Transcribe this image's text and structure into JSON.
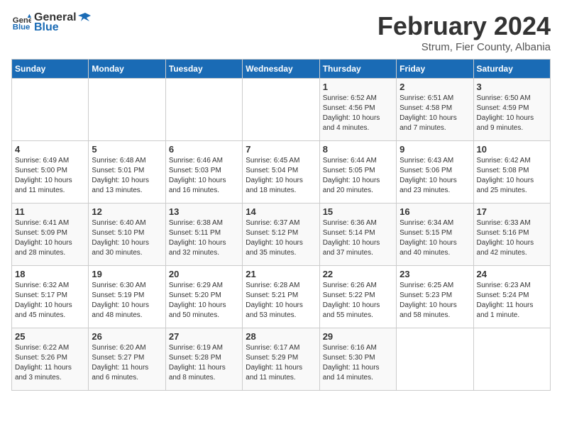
{
  "header": {
    "logo_general": "General",
    "logo_blue": "Blue",
    "month_title": "February 2024",
    "subtitle": "Strum, Fier County, Albania"
  },
  "days_of_week": [
    "Sunday",
    "Monday",
    "Tuesday",
    "Wednesday",
    "Thursday",
    "Friday",
    "Saturday"
  ],
  "weeks": [
    [
      {
        "day": "",
        "info": ""
      },
      {
        "day": "",
        "info": ""
      },
      {
        "day": "",
        "info": ""
      },
      {
        "day": "",
        "info": ""
      },
      {
        "day": "1",
        "info": "Sunrise: 6:52 AM\nSunset: 4:56 PM\nDaylight: 10 hours\nand 4 minutes."
      },
      {
        "day": "2",
        "info": "Sunrise: 6:51 AM\nSunset: 4:58 PM\nDaylight: 10 hours\nand 7 minutes."
      },
      {
        "day": "3",
        "info": "Sunrise: 6:50 AM\nSunset: 4:59 PM\nDaylight: 10 hours\nand 9 minutes."
      }
    ],
    [
      {
        "day": "4",
        "info": "Sunrise: 6:49 AM\nSunset: 5:00 PM\nDaylight: 10 hours\nand 11 minutes."
      },
      {
        "day": "5",
        "info": "Sunrise: 6:48 AM\nSunset: 5:01 PM\nDaylight: 10 hours\nand 13 minutes."
      },
      {
        "day": "6",
        "info": "Sunrise: 6:46 AM\nSunset: 5:03 PM\nDaylight: 10 hours\nand 16 minutes."
      },
      {
        "day": "7",
        "info": "Sunrise: 6:45 AM\nSunset: 5:04 PM\nDaylight: 10 hours\nand 18 minutes."
      },
      {
        "day": "8",
        "info": "Sunrise: 6:44 AM\nSunset: 5:05 PM\nDaylight: 10 hours\nand 20 minutes."
      },
      {
        "day": "9",
        "info": "Sunrise: 6:43 AM\nSunset: 5:06 PM\nDaylight: 10 hours\nand 23 minutes."
      },
      {
        "day": "10",
        "info": "Sunrise: 6:42 AM\nSunset: 5:08 PM\nDaylight: 10 hours\nand 25 minutes."
      }
    ],
    [
      {
        "day": "11",
        "info": "Sunrise: 6:41 AM\nSunset: 5:09 PM\nDaylight: 10 hours\nand 28 minutes."
      },
      {
        "day": "12",
        "info": "Sunrise: 6:40 AM\nSunset: 5:10 PM\nDaylight: 10 hours\nand 30 minutes."
      },
      {
        "day": "13",
        "info": "Sunrise: 6:38 AM\nSunset: 5:11 PM\nDaylight: 10 hours\nand 32 minutes."
      },
      {
        "day": "14",
        "info": "Sunrise: 6:37 AM\nSunset: 5:12 PM\nDaylight: 10 hours\nand 35 minutes."
      },
      {
        "day": "15",
        "info": "Sunrise: 6:36 AM\nSunset: 5:14 PM\nDaylight: 10 hours\nand 37 minutes."
      },
      {
        "day": "16",
        "info": "Sunrise: 6:34 AM\nSunset: 5:15 PM\nDaylight: 10 hours\nand 40 minutes."
      },
      {
        "day": "17",
        "info": "Sunrise: 6:33 AM\nSunset: 5:16 PM\nDaylight: 10 hours\nand 42 minutes."
      }
    ],
    [
      {
        "day": "18",
        "info": "Sunrise: 6:32 AM\nSunset: 5:17 PM\nDaylight: 10 hours\nand 45 minutes."
      },
      {
        "day": "19",
        "info": "Sunrise: 6:30 AM\nSunset: 5:19 PM\nDaylight: 10 hours\nand 48 minutes."
      },
      {
        "day": "20",
        "info": "Sunrise: 6:29 AM\nSunset: 5:20 PM\nDaylight: 10 hours\nand 50 minutes."
      },
      {
        "day": "21",
        "info": "Sunrise: 6:28 AM\nSunset: 5:21 PM\nDaylight: 10 hours\nand 53 minutes."
      },
      {
        "day": "22",
        "info": "Sunrise: 6:26 AM\nSunset: 5:22 PM\nDaylight: 10 hours\nand 55 minutes."
      },
      {
        "day": "23",
        "info": "Sunrise: 6:25 AM\nSunset: 5:23 PM\nDaylight: 10 hours\nand 58 minutes."
      },
      {
        "day": "24",
        "info": "Sunrise: 6:23 AM\nSunset: 5:24 PM\nDaylight: 11 hours\nand 1 minute."
      }
    ],
    [
      {
        "day": "25",
        "info": "Sunrise: 6:22 AM\nSunset: 5:26 PM\nDaylight: 11 hours\nand 3 minutes."
      },
      {
        "day": "26",
        "info": "Sunrise: 6:20 AM\nSunset: 5:27 PM\nDaylight: 11 hours\nand 6 minutes."
      },
      {
        "day": "27",
        "info": "Sunrise: 6:19 AM\nSunset: 5:28 PM\nDaylight: 11 hours\nand 8 minutes."
      },
      {
        "day": "28",
        "info": "Sunrise: 6:17 AM\nSunset: 5:29 PM\nDaylight: 11 hours\nand 11 minutes."
      },
      {
        "day": "29",
        "info": "Sunrise: 6:16 AM\nSunset: 5:30 PM\nDaylight: 11 hours\nand 14 minutes."
      },
      {
        "day": "",
        "info": ""
      },
      {
        "day": "",
        "info": ""
      }
    ]
  ]
}
